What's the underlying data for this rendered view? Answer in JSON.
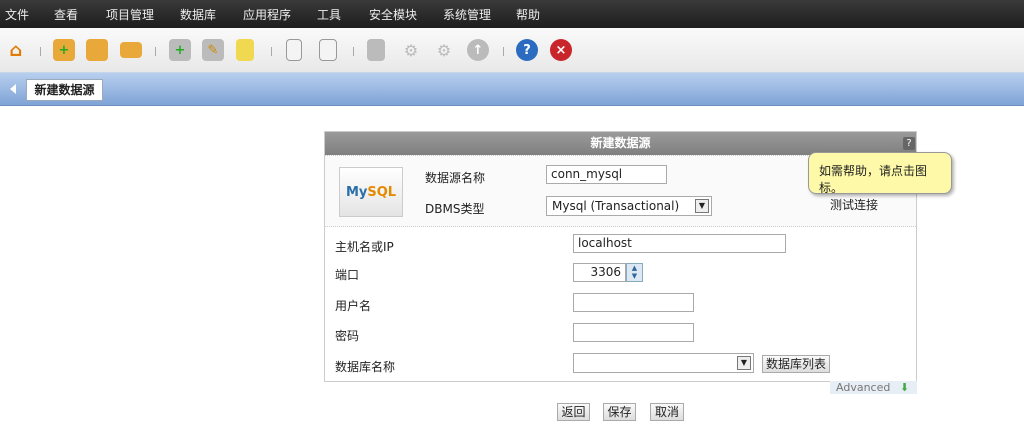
{
  "menu": [
    "文件",
    "查看",
    "项目管理",
    "数据库",
    "应用程序",
    "工具",
    "安全模块",
    "系统管理",
    "帮助"
  ],
  "toolbar": [
    "home-icon",
    "new-folder-icon",
    "open-folder-icon",
    "folder-icon",
    "add-database-icon",
    "edit-database-icon",
    "database-icon",
    "new-page-icon",
    "copy-page-icon",
    "save-icon",
    "settings-icon",
    "settings2-icon",
    "upload-icon",
    "help-icon",
    "close-icon"
  ],
  "tab": {
    "label": "新建数据源"
  },
  "dialog": {
    "title": "新建数据源",
    "help": "?",
    "logo": {
      "my": "My",
      "sql": "SQL"
    },
    "ds_name_label": "数据源名称",
    "ds_name_value": "conn_mysql",
    "dbms_label": "DBMS类型",
    "dbms_value": "Mysql (Transactional)",
    "test_connection": "测试连接",
    "tooltip": "如需帮助，请点击图标。",
    "host_label": "主机名或IP",
    "host_value": "localhost",
    "port_label": "端口",
    "port_value": "3306",
    "user_label": "用户名",
    "user_value": "",
    "password_label": "密码",
    "password_value": "",
    "dbname_label": "数据库名称",
    "dbname_value": "",
    "dblist_button": "数据库列表",
    "advanced": "Advanced"
  },
  "buttons": {
    "back": "返回",
    "save": "保存",
    "cancel": "取消"
  }
}
